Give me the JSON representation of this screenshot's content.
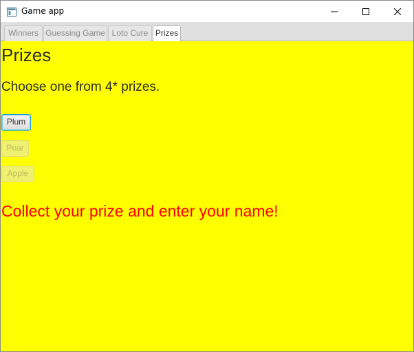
{
  "window": {
    "title": "Game app",
    "icon": "app-window-icon",
    "controls": {
      "minimize": "minimize-icon",
      "maximize": "maximize-icon",
      "close": "close-icon"
    }
  },
  "tabs": [
    {
      "label": "Winners",
      "active": false
    },
    {
      "label": "Guessing Game",
      "active": false
    },
    {
      "label": "Loto Cure",
      "active": false
    },
    {
      "label": "Prizes",
      "active": true
    }
  ],
  "content": {
    "title": "Prizes",
    "subtitle": "Choose one from 4* prizes.",
    "prizes": [
      {
        "label": "Plum",
        "enabled": true,
        "focused": true
      },
      {
        "label": "Pear",
        "enabled": false
      },
      {
        "label": "Apple",
        "enabled": false
      }
    ],
    "message": "Collect your prize and enter your name!"
  },
  "colors": {
    "background": "#ffff00",
    "message": "#ff0000",
    "focus_ring": "#1a9fd6"
  }
}
